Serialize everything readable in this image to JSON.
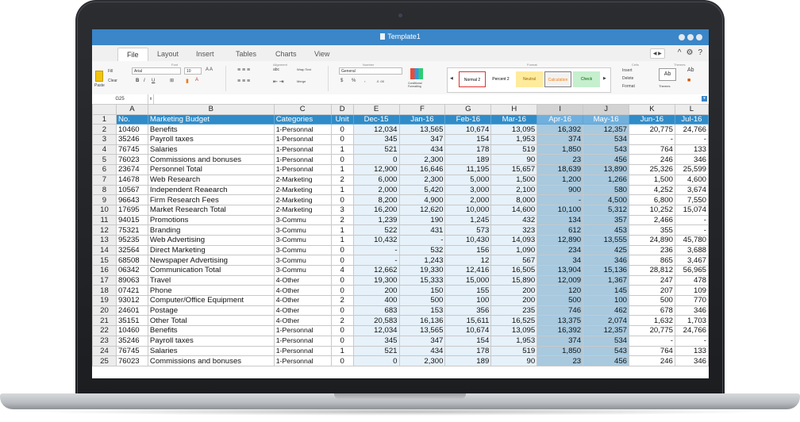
{
  "window": {
    "title": "Template1"
  },
  "menu": {
    "tabs": [
      "File",
      "Layout",
      "Insert",
      "Tables",
      "Charts",
      "View"
    ],
    "active": "File"
  },
  "ribbon": {
    "groups": {
      "font": "Font",
      "alignment": "Alignment",
      "number": "Number",
      "format": "Format",
      "cells": "Cells",
      "themes": "Themes"
    },
    "paste": "Paste",
    "fill": "Fill",
    "clear": "Clear",
    "font_name": "Arial",
    "font_size": "10",
    "bold": "B",
    "italic": "I",
    "underline": "U",
    "wrap_text": "Wrap Text",
    "merge": "Merge",
    "abc": "abc",
    "number_format": "General",
    "currency": "$",
    "percent": "%",
    "comma": ",",
    "dec_inc": ".0 .00",
    "conditional_formatting": "Conditional Formatting",
    "styles": [
      "Normal 2",
      "Percent 2",
      "Neutral",
      "Calculation",
      "Check"
    ],
    "insert": "Insert",
    "delete": "Delete",
    "format_btn": "Format",
    "themes_label": "Themes",
    "ab": "Ab"
  },
  "formula_bar": {
    "cell_ref": "G25",
    "value": ""
  },
  "columns": [
    "A",
    "B",
    "C",
    "D",
    "E",
    "F",
    "G",
    "H",
    "I",
    "J",
    "K",
    "L"
  ],
  "header_row": [
    "No.",
    "Marketing Budget",
    "Categories",
    "Unit",
    "Dec-15",
    "Jan-16",
    "Feb-16",
    "Mar-16",
    "Apr-16",
    "May-16",
    "Jun-16",
    "Jul-16"
  ],
  "rows": [
    [
      "10460",
      "Benefits",
      "1-Personnal",
      "0",
      "12,034",
      "13,565",
      "10,674",
      "13,095",
      "16,392",
      "12,357",
      "20,775",
      "24,766"
    ],
    [
      "35246",
      "Payroll taxes",
      "1-Personnal",
      "0",
      "345",
      "347",
      "154",
      "1,953",
      "374",
      "534",
      "-",
      "-"
    ],
    [
      "76745",
      "Salaries",
      "1-Personnal",
      "1",
      "521",
      "434",
      "178",
      "519",
      "1,850",
      "543",
      "764",
      "133"
    ],
    [
      "76023",
      "Commissions and bonuses",
      "1-Personnal",
      "0",
      "0",
      "2,300",
      "189",
      "90",
      "23",
      "456",
      "246",
      "346"
    ],
    [
      "23674",
      "Personnel Total",
      "1-Personnal",
      "1",
      "12,900",
      "16,646",
      "11,195",
      "15,657",
      "18,639",
      "13,890",
      "25,326",
      "25,599"
    ],
    [
      "14678",
      "Web Research",
      "2-Marketing",
      "2",
      "6,000",
      "2,300",
      "5,000",
      "1,500",
      "1,200",
      "1,266",
      "1,500",
      "4,600"
    ],
    [
      "10567",
      "Independent Reaearch",
      "2-Marketing",
      "1",
      "2,000",
      "5,420",
      "3,000",
      "2,100",
      "900",
      "580",
      "4,252",
      "3,674"
    ],
    [
      "96643",
      "Firm Research Fees",
      "2-Marketing",
      "0",
      "8,200",
      "4,900",
      "2,000",
      "8,000",
      "-",
      "4,500",
      "6,800",
      "7,550"
    ],
    [
      "17695",
      "Market Research Total",
      "2-Marketing",
      "3",
      "16,200",
      "12,620",
      "10,000",
      "14,600",
      "10,100",
      "5,312",
      "10,252",
      "15,074"
    ],
    [
      "94015",
      "Promotions",
      "3-Commu",
      "2",
      "1,239",
      "190",
      "1,245",
      "432",
      "134",
      "357",
      "2,466",
      "-"
    ],
    [
      "75321",
      "Branding",
      "3-Commu",
      "1",
      "522",
      "431",
      "573",
      "323",
      "612",
      "453",
      "355",
      "-"
    ],
    [
      "95235",
      "Web Advertising",
      "3-Commu",
      "1",
      "10,432",
      "-",
      "10,430",
      "14,093",
      "12,890",
      "13,555",
      "24,890",
      "45,780"
    ],
    [
      "32564",
      "Direct Marketing",
      "3-Commu",
      "0",
      "-",
      "532",
      "156",
      "1,090",
      "234",
      "425",
      "236",
      "3,688"
    ],
    [
      "68508",
      "Newspaper Advertising",
      "3-Commu",
      "0",
      "-",
      "1,243",
      "12",
      "567",
      "34",
      "346",
      "865",
      "3,467"
    ],
    [
      "06342",
      "Communication Total",
      "3-Commu",
      "4",
      "12,662",
      "19,330",
      "12,416",
      "16,505",
      "13,904",
      "15,136",
      "28,812",
      "56,965"
    ],
    [
      "89063",
      "Travel",
      "4-Other",
      "0",
      "19,300",
      "15,333",
      "15,000",
      "15,890",
      "12,009",
      "1,367",
      "247",
      "478"
    ],
    [
      "07421",
      "Phone",
      "4-Other",
      "0",
      "200",
      "150",
      "155",
      "200",
      "120",
      "145",
      "207",
      "109"
    ],
    [
      "93012",
      "Computer/Office Equipment",
      "4-Other",
      "2",
      "400",
      "500",
      "100",
      "200",
      "500",
      "100",
      "500",
      "770"
    ],
    [
      "24601",
      "Postage",
      "4-Other",
      "0",
      "683",
      "153",
      "356",
      "235",
      "746",
      "462",
      "678",
      "346"
    ],
    [
      "35151",
      "Other Total",
      "4-Other",
      "2",
      "20,583",
      "16,136",
      "15,611",
      "16,525",
      "13,375",
      "2,074",
      "1,632",
      "1,703"
    ],
    [
      "10460",
      "Benefits",
      "1-Personnal",
      "0",
      "12,034",
      "13,565",
      "10,674",
      "13,095",
      "16,392",
      "12,357",
      "20,775",
      "24,766"
    ],
    [
      "35246",
      "Payroll taxes",
      "1-Personnal",
      "0",
      "345",
      "347",
      "154",
      "1,953",
      "374",
      "534",
      "-",
      "-"
    ],
    [
      "76745",
      "Salaries",
      "1-Personnal",
      "1",
      "521",
      "434",
      "178",
      "519",
      "1,850",
      "543",
      "764",
      "133"
    ],
    [
      "76023",
      "Commissions and bonuses",
      "1-Personnal",
      "0",
      "0",
      "2,300",
      "189",
      "90",
      "23",
      "456",
      "246",
      "346"
    ]
  ]
}
